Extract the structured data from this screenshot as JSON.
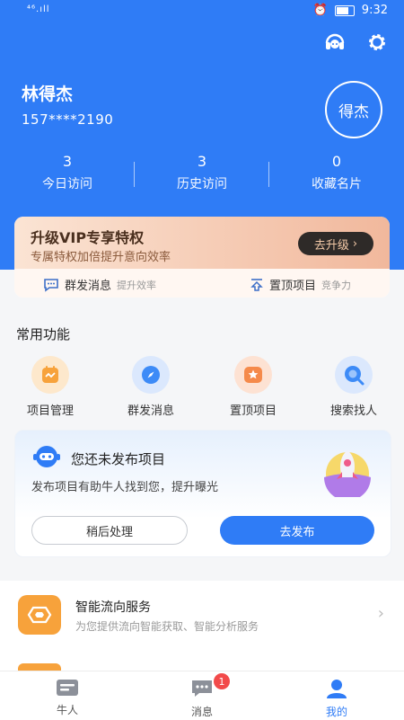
{
  "status_bar": {
    "signal": "⁴⁶.ıll",
    "time": "9:32"
  },
  "header": {
    "user_name": "林得杰",
    "phone": "157****2190",
    "avatar_text": "得杰",
    "icons": {
      "service": "headset-icon",
      "settings": "gear-icon"
    }
  },
  "stats": [
    {
      "value": "3",
      "label": "今日访问"
    },
    {
      "value": "3",
      "label": "历史访问"
    },
    {
      "value": "0",
      "label": "收藏名片"
    }
  ],
  "vip": {
    "title": "升级VIP专享特权",
    "subtitle": "专属特权加倍提升意向效率",
    "button": "去升级",
    "features": [
      {
        "label": "群发消息",
        "tag": "提升效率"
      },
      {
        "label": "置顶项目",
        "tag": "竞争力"
      }
    ]
  },
  "common": {
    "title": "常用功能",
    "items": [
      {
        "label": "项目管理",
        "icon": "project-icon",
        "color": "#f7a23b"
      },
      {
        "label": "群发消息",
        "icon": "compass-icon",
        "color": "#3d8bf7"
      },
      {
        "label": "置顶项目",
        "icon": "star-icon",
        "color": "#f58a4b"
      },
      {
        "label": "搜索找人",
        "icon": "search-icon",
        "color": "#3d8bf7"
      }
    ]
  },
  "publish": {
    "title": "您还未发布项目",
    "desc": "发布项目有助牛人找到您，提升曝光",
    "later": "稍后处理",
    "publish": "去发布"
  },
  "service": {
    "title": "智能流向服务",
    "subtitle": "为您提供流向智能获取、智能分析服务"
  },
  "tabs": [
    {
      "label": "牛人",
      "icon": "card-icon",
      "active": false
    },
    {
      "label": "消息",
      "icon": "message-icon",
      "active": false,
      "badge": "1"
    },
    {
      "label": "我的",
      "icon": "profile-icon",
      "active": true
    }
  ],
  "colors": {
    "brand": "#2f7cf6",
    "vip_dark": "#2e2a28",
    "badge": "#f24a4a"
  }
}
